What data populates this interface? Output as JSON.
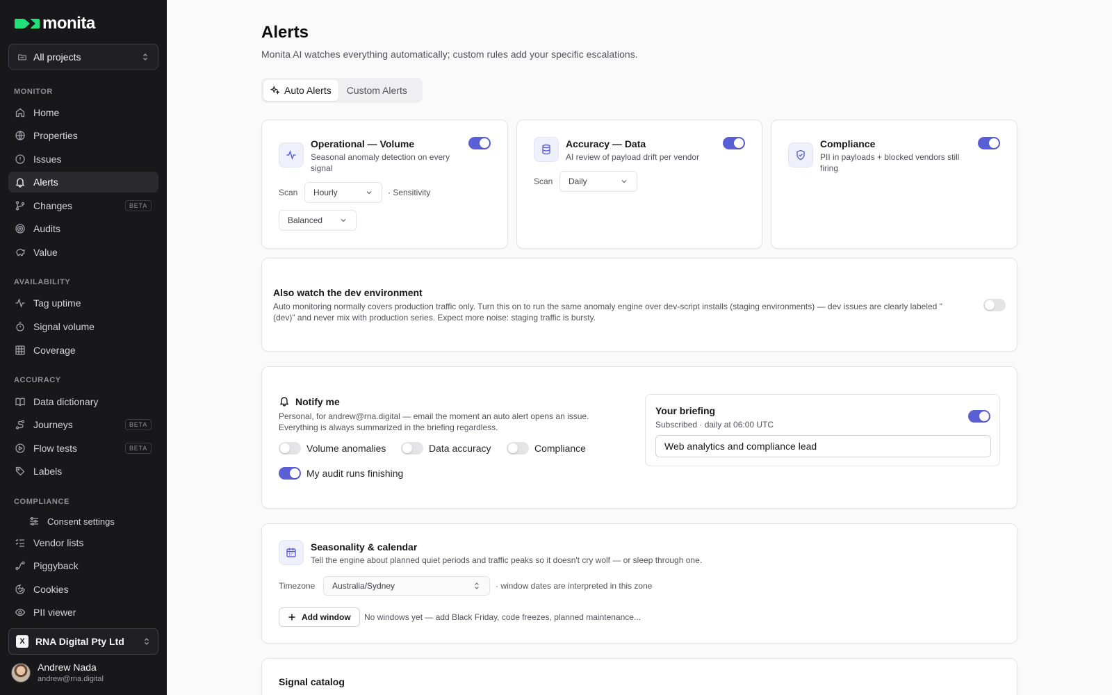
{
  "app": {
    "name": "monita"
  },
  "colors": {
    "sidebar_bg": "#18181b",
    "accent": "#5b5fd6",
    "logo_green": "#22e07a"
  },
  "sidebar": {
    "project_selector": "All projects",
    "sections": {
      "monitor": "MONITOR",
      "availability": "AVAILABILITY",
      "accuracy": "ACCURACY",
      "compliance": "COMPLIANCE"
    },
    "items": {
      "home": "Home",
      "properties": "Properties",
      "issues": "Issues",
      "alerts": "Alerts",
      "changes": "Changes",
      "audits": "Audits",
      "value": "Value",
      "tag_uptime": "Tag uptime",
      "signal_volume": "Signal volume",
      "coverage": "Coverage",
      "data_dictionary": "Data dictionary",
      "journeys": "Journeys",
      "flow_tests": "Flow tests",
      "labels": "Labels",
      "consent_settings": "Consent settings",
      "vendor_lists": "Vendor lists",
      "piggyback": "Piggyback",
      "cookies": "Cookies",
      "pii_viewer": "PII viewer"
    },
    "beta_label": "BETA",
    "active_item": "Alerts",
    "org": {
      "name": "RNA Digital Pty Ltd",
      "logo_glyph": "X"
    },
    "user": {
      "name": "Andrew Nada",
      "email": "andrew@rna.digital"
    }
  },
  "main": {
    "title": "Alerts",
    "subtitle": "Monita AI watches everything automatically; custom rules add your specific escalations.",
    "tabs": {
      "auto": "Auto Alerts",
      "custom": "Custom Alerts"
    },
    "active_tab": "Auto Alerts",
    "cards": {
      "operational": {
        "title": "Operational — Volume",
        "desc": "Seasonal anomaly detection on every signal",
        "enabled": true,
        "scan_label": "Scan",
        "scan_value": "Hourly",
        "sensitivity_label": "· Sensitivity",
        "sensitivity_value": "Balanced"
      },
      "accuracy": {
        "title": "Accuracy — Data",
        "desc": "AI review of payload drift per vendor",
        "enabled": true,
        "scan_label": "Scan",
        "scan_value": "Daily"
      },
      "compliance": {
        "title": "Compliance",
        "desc": "PII in payloads + blocked vendors still firing",
        "enabled": true
      }
    },
    "dev_env": {
      "title": "Also watch the dev environment",
      "desc": "Auto monitoring normally covers production traffic only. Turn this on to run the same anomaly engine over dev-script installs (staging environments) — dev issues are clearly labeled \"(dev)\" and never mix with production series. Expect more noise: staging traffic is bursty.",
      "enabled": false
    },
    "notify": {
      "title": "Notify me",
      "desc": "Personal, for andrew@rna.digital — email the moment an auto alert opens an issue. Everything is always summarized in the briefing regardless.",
      "options": {
        "volume": {
          "label": "Volume anomalies",
          "on": false
        },
        "accuracy": {
          "label": "Data accuracy",
          "on": false
        },
        "compliance": {
          "label": "Compliance",
          "on": false
        },
        "audits": {
          "label": "My audit runs finishing",
          "on": true
        }
      },
      "briefing": {
        "title": "Your briefing",
        "status": "Subscribed · daily at 06:00 UTC",
        "enabled": true,
        "role_value": "Web analytics and compliance lead"
      }
    },
    "seasonality": {
      "title": "Seasonality & calendar",
      "desc": "Tell the engine about planned quiet periods and traffic peaks so it doesn't cry wolf — or sleep through one.",
      "timezone_label": "Timezone",
      "timezone_value": "Australia/Sydney",
      "timezone_hint": "· window dates are interpreted in this zone",
      "add_window": "Add window",
      "empty_hint": "No windows yet — add Black Friday, code freezes, planned maintenance..."
    },
    "signal_catalog": {
      "title": "Signal catalog"
    }
  }
}
